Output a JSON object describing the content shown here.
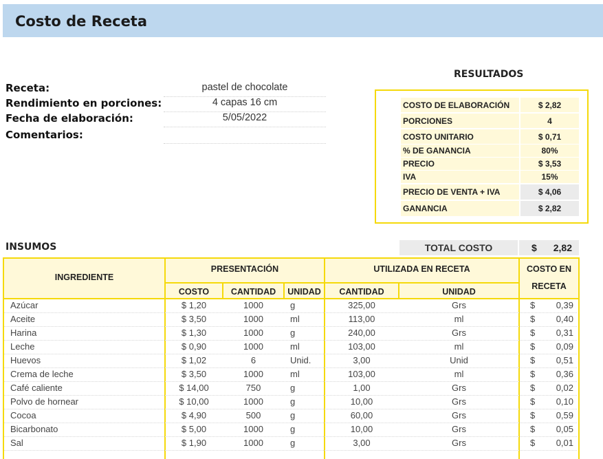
{
  "header": {
    "title": "Costo de Receta"
  },
  "info": {
    "receta_label": "Receta:",
    "receta_value": "pastel de chocolate",
    "rendimiento_label": "Rendimiento en porciones:",
    "rendimiento_value": "4 capas 16 cm",
    "fecha_label": "Fecha de elaboración:",
    "fecha_value": "5/05/2022",
    "comentarios_label": "Comentarios:",
    "comentarios_value": ""
  },
  "resultados": {
    "title": "RESULTADOS",
    "rows": [
      {
        "label": "COSTO DE ELABORACIÓN",
        "value": "$ 2,82"
      },
      {
        "label": "PORCIONES",
        "value": "4"
      },
      {
        "label": "COSTO UNITARIO",
        "value": "$ 0,71"
      },
      {
        "label": "% DE GANANCIA",
        "value": "80%"
      },
      {
        "label": "PRECIO",
        "value": "$ 3,53"
      },
      {
        "label": "IVA",
        "value": "15%"
      },
      {
        "label": "PRECIO DE VENTA + IVA",
        "value": "$ 4,06"
      },
      {
        "label": "GANANCIA",
        "value": "$ 2,82"
      }
    ]
  },
  "insumos": {
    "title": "INSUMOS",
    "total_label": "TOTAL COSTO",
    "total_currency": "$",
    "total_value": "2,82",
    "headers": {
      "ingrediente": "INGREDIENTE",
      "presentacion": "PRESENTACIÓN",
      "utilizada": "UTILIZADA EN RECETA",
      "costo_en_receta_1": "COSTO EN",
      "costo_en_receta_2": "RECETA",
      "costo": "COSTO",
      "cantidad": "CANTIDAD",
      "unidad": "UNIDAD",
      "cantidad_r": "CANTIDAD",
      "unidad_r": "UNIDAD"
    },
    "currency": "$",
    "rows": [
      {
        "ingrediente": "Azúcar",
        "costo": "$ 1,20",
        "cantidad": "1000",
        "unidad": "g",
        "cantidad_r": "325,00",
        "unidad_r": "Grs",
        "costo_receta": "0,39"
      },
      {
        "ingrediente": "Aceite",
        "costo": "$ 3,50",
        "cantidad": "1000",
        "unidad": "ml",
        "cantidad_r": "113,00",
        "unidad_r": "ml",
        "costo_receta": "0,40"
      },
      {
        "ingrediente": "Harina",
        "costo": "$ 1,30",
        "cantidad": "1000",
        "unidad": "g",
        "cantidad_r": "240,00",
        "unidad_r": "Grs",
        "costo_receta": "0,31"
      },
      {
        "ingrediente": "Leche",
        "costo": "$ 0,90",
        "cantidad": "1000",
        "unidad": "ml",
        "cantidad_r": "103,00",
        "unidad_r": "ml",
        "costo_receta": "0,09"
      },
      {
        "ingrediente": "Huevos",
        "costo": "$ 1,02",
        "cantidad": "6",
        "unidad": "Unid.",
        "cantidad_r": "3,00",
        "unidad_r": "Unid",
        "costo_receta": "0,51"
      },
      {
        "ingrediente": "Crema de leche",
        "costo": "$ 3,50",
        "cantidad": "1000",
        "unidad": "ml",
        "cantidad_r": "103,00",
        "unidad_r": "ml",
        "costo_receta": "0,36"
      },
      {
        "ingrediente": "Café caliente",
        "costo": "$ 14,00",
        "cantidad": "750",
        "unidad": "g",
        "cantidad_r": "1,00",
        "unidad_r": "Grs",
        "costo_receta": "0,02"
      },
      {
        "ingrediente": "Polvo de hornear",
        "costo": "$ 10,00",
        "cantidad": "1000",
        "unidad": "g",
        "cantidad_r": "10,00",
        "unidad_r": "Grs",
        "costo_receta": "0,10"
      },
      {
        "ingrediente": "Cocoa",
        "costo": "$ 4,90",
        "cantidad": "500",
        "unidad": "g",
        "cantidad_r": "60,00",
        "unidad_r": "Grs",
        "costo_receta": "0,59"
      },
      {
        "ingrediente": "Bicarbonato",
        "costo": "$ 5,00",
        "cantidad": "1000",
        "unidad": "g",
        "cantidad_r": "10,00",
        "unidad_r": "Grs",
        "costo_receta": "0,05"
      },
      {
        "ingrediente": "Sal",
        "costo": "$ 1,90",
        "cantidad": "1000",
        "unidad": "g",
        "cantidad_r": "3,00",
        "unidad_r": "Grs",
        "costo_receta": "0,01"
      }
    ]
  },
  "colors": {
    "title_bar": "#bdd7ee",
    "border": "#f5d90a",
    "header_fill": "#fff9d9",
    "highlight": "#ebebeb"
  }
}
